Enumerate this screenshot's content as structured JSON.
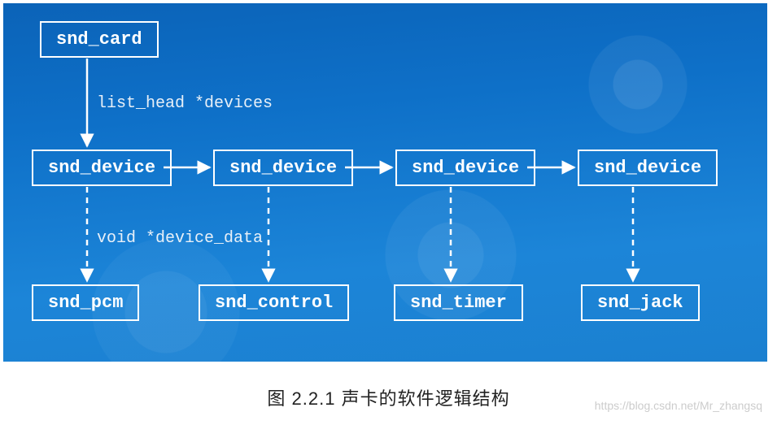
{
  "diagram": {
    "nodes": {
      "snd_card": "snd_card",
      "snd_device_1": "snd_device",
      "snd_device_2": "snd_device",
      "snd_device_3": "snd_device",
      "snd_device_4": "snd_device",
      "snd_pcm": "snd_pcm",
      "snd_control": "snd_control",
      "snd_timer": "snd_timer",
      "snd_jack": "snd_jack"
    },
    "edge_labels": {
      "list_head_devices": "list_head *devices",
      "void_device_data": "void *device_data"
    }
  },
  "caption": "图 2.2.1  声卡的软件逻辑结构",
  "watermark": "https://blog.csdn.net/Mr_zhangsq",
  "chart_data": {
    "type": "diagram",
    "title": "图 2.2.1 声卡的软件逻辑结构",
    "nodes": [
      {
        "id": "snd_card",
        "label": "snd_card",
        "row": 0,
        "col": 0
      },
      {
        "id": "snd_device_1",
        "label": "snd_device",
        "row": 1,
        "col": 0
      },
      {
        "id": "snd_device_2",
        "label": "snd_device",
        "row": 1,
        "col": 1
      },
      {
        "id": "snd_device_3",
        "label": "snd_device",
        "row": 1,
        "col": 2
      },
      {
        "id": "snd_device_4",
        "label": "snd_device",
        "row": 1,
        "col": 3
      },
      {
        "id": "snd_pcm",
        "label": "snd_pcm",
        "row": 2,
        "col": 0
      },
      {
        "id": "snd_control",
        "label": "snd_control",
        "row": 2,
        "col": 1
      },
      {
        "id": "snd_timer",
        "label": "snd_timer",
        "row": 2,
        "col": 2
      },
      {
        "id": "snd_jack",
        "label": "snd_jack",
        "row": 2,
        "col": 3
      }
    ],
    "edges": [
      {
        "from": "snd_card",
        "to": "snd_device_1",
        "style": "solid",
        "label": "list_head *devices"
      },
      {
        "from": "snd_device_1",
        "to": "snd_device_2",
        "style": "solid"
      },
      {
        "from": "snd_device_2",
        "to": "snd_device_3",
        "style": "solid"
      },
      {
        "from": "snd_device_3",
        "to": "snd_device_4",
        "style": "solid"
      },
      {
        "from": "snd_device_1",
        "to": "snd_pcm",
        "style": "dashed",
        "label": "void *device_data"
      },
      {
        "from": "snd_device_2",
        "to": "snd_control",
        "style": "dashed"
      },
      {
        "from": "snd_device_3",
        "to": "snd_timer",
        "style": "dashed"
      },
      {
        "from": "snd_device_4",
        "to": "snd_jack",
        "style": "dashed"
      }
    ]
  }
}
